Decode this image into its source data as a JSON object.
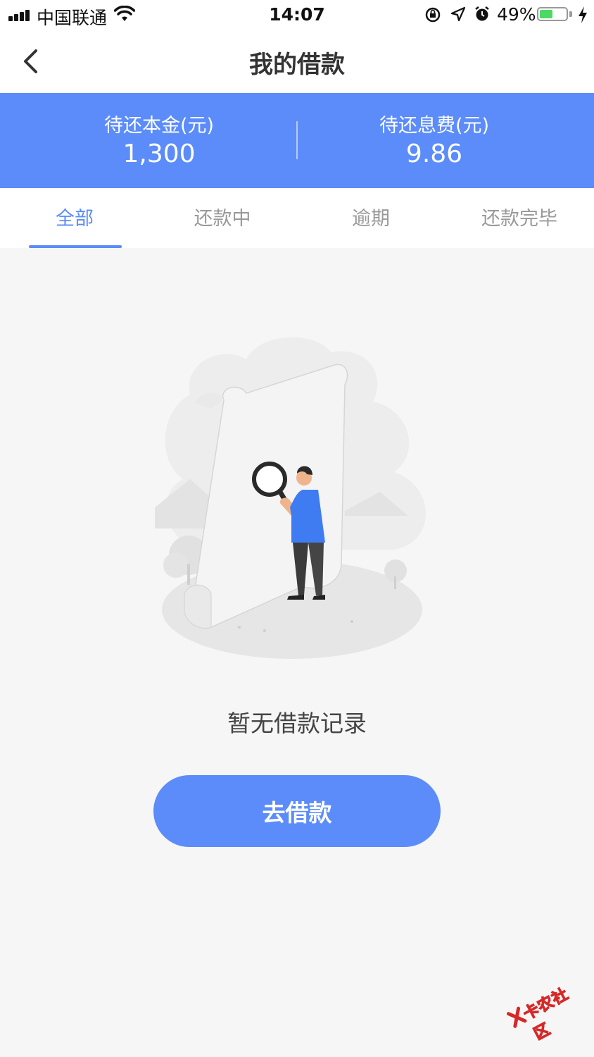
{
  "status_bar": {
    "carrier": "中国联通",
    "time": "14:07",
    "battery_percent": "49%",
    "battery_level": 0.49,
    "icons": [
      "signal-icon",
      "wifi-icon",
      "rotation-lock-icon",
      "location-icon",
      "alarm-icon",
      "battery-icon",
      "charging-icon"
    ]
  },
  "nav": {
    "title": "我的借款",
    "back_icon": "chevron-left-icon"
  },
  "summary": {
    "principal_label": "待还本金(元)",
    "principal_value": "1,300",
    "interest_label": "待还息费(元)",
    "interest_value": "9.86"
  },
  "tabs": [
    {
      "label": "全部",
      "active": true
    },
    {
      "label": "还款中",
      "active": false
    },
    {
      "label": "逾期",
      "active": false
    },
    {
      "label": "还款完毕",
      "active": false
    }
  ],
  "empty_state": {
    "message": "暂无借款记录",
    "illustration": "magnifier-search-illustration"
  },
  "cta": {
    "label": "去借款"
  },
  "watermark": {
    "text": "卡农社区"
  },
  "colors": {
    "accent": "#5b8cf9",
    "background": "#f6f6f6",
    "tab_inactive": "#999999"
  }
}
